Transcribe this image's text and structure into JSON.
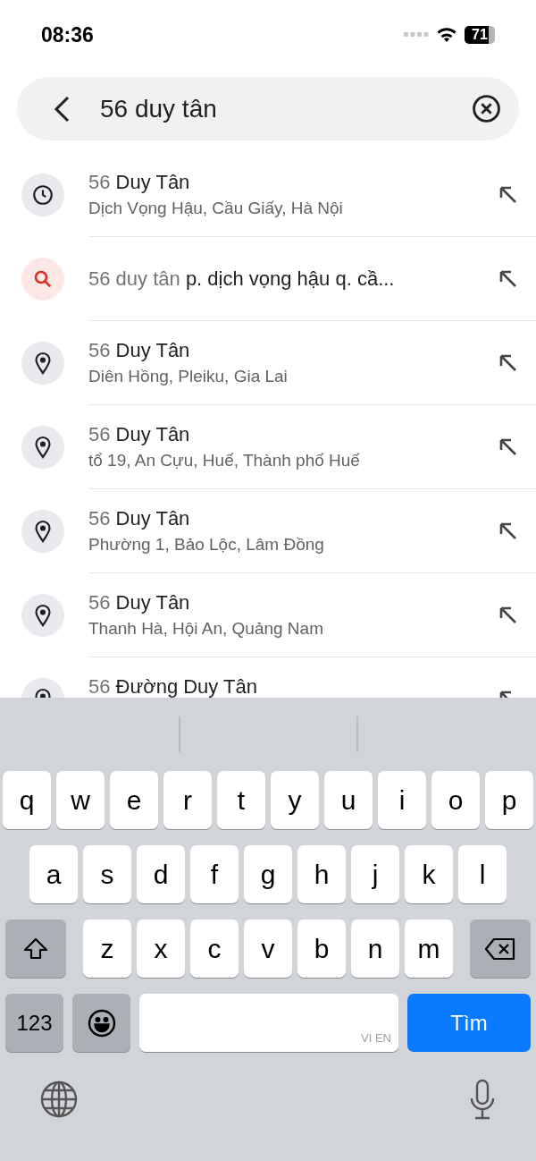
{
  "status_bar": {
    "time": "08:36",
    "battery": "71"
  },
  "search": {
    "value": "56 duy tân"
  },
  "results": [
    {
      "kind": "recent",
      "prefix": "56",
      "title": "Duy Tân",
      "subtitle": "Dịch Vọng Hậu, Cầu Giấy, Hà Nội"
    },
    {
      "kind": "search",
      "prefix": "56 duy tân",
      "title": "p. dịch vọng hậu q. cầ..."
    },
    {
      "kind": "place",
      "prefix": "56",
      "title": "Duy Tân",
      "subtitle": "Diên Hồng, Pleiku, Gia Lai"
    },
    {
      "kind": "place",
      "prefix": "56",
      "title": "Duy Tân",
      "subtitle": "tổ 19, An Cựu, Huế, Thành phố Huế"
    },
    {
      "kind": "place",
      "prefix": "56",
      "title": "Duy Tân",
      "subtitle": "Phường 1, Bảo Lộc, Lâm Đồng"
    },
    {
      "kind": "place",
      "prefix": "56",
      "title": "Duy Tân",
      "subtitle": "Thanh Hà, Hội An, Quảng Nam"
    },
    {
      "kind": "place",
      "prefix": "56",
      "title": "Đường Duy Tân"
    }
  ],
  "keyboard": {
    "rows": [
      [
        "q",
        "w",
        "e",
        "r",
        "t",
        "y",
        "u",
        "i",
        "o",
        "p"
      ],
      [
        "a",
        "s",
        "d",
        "f",
        "g",
        "h",
        "j",
        "k",
        "l"
      ],
      [
        "z",
        "x",
        "c",
        "v",
        "b",
        "n",
        "m"
      ]
    ],
    "numbers_key": "123",
    "space_hint": "VI EN",
    "return_key": "Tìm"
  }
}
